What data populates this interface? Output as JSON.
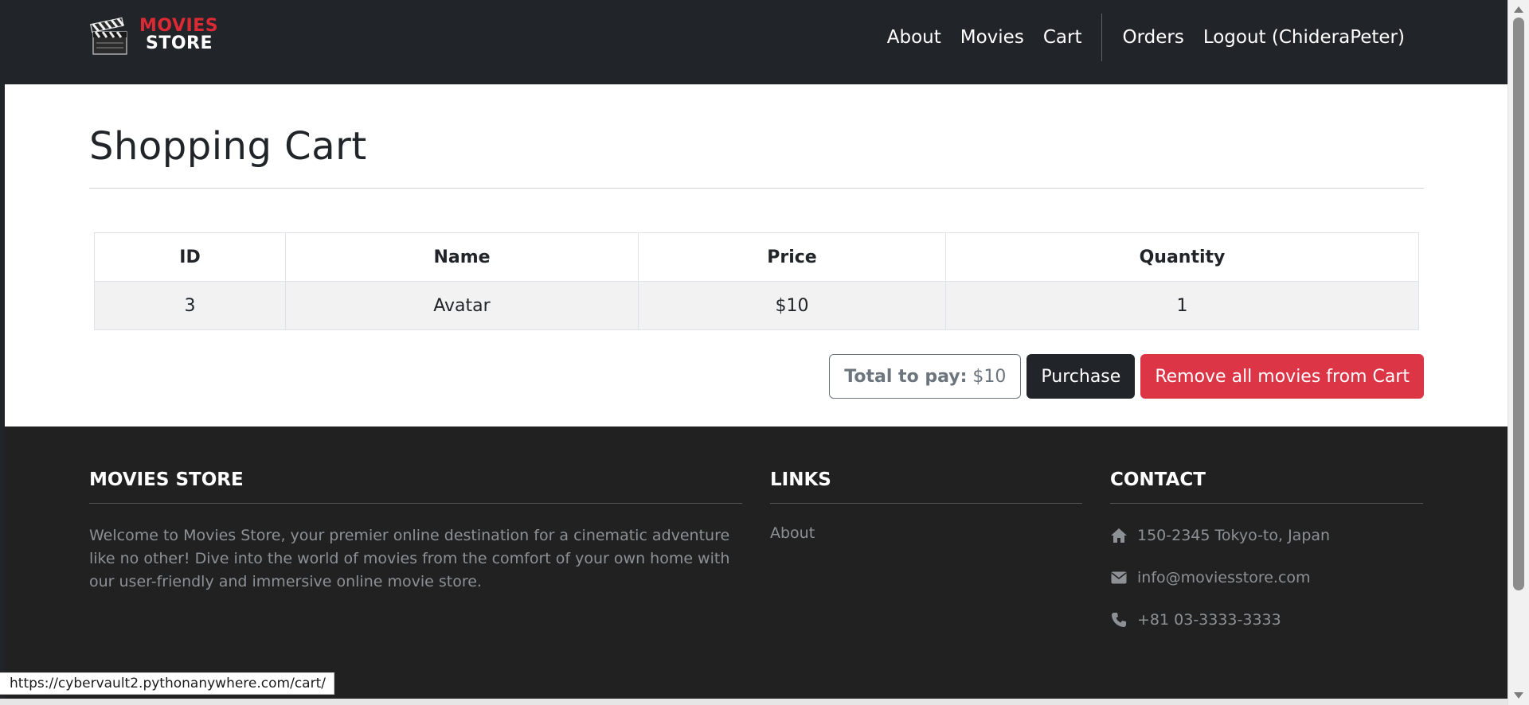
{
  "navbar": {
    "brand_line1": "MOVIES",
    "brand_line2": "STORE",
    "links": {
      "about": "About",
      "movies": "Movies",
      "cart": "Cart",
      "orders": "Orders",
      "logout": "Logout (ChideraPeter)"
    }
  },
  "main": {
    "title": "Shopping Cart",
    "table": {
      "headers": [
        "ID",
        "Name",
        "Price",
        "Quantity"
      ],
      "rows": [
        [
          "3",
          "Avatar",
          "$10",
          "1"
        ]
      ]
    },
    "total_label": "Total to pay:",
    "total_value": "$10",
    "purchase_label": "Purchase",
    "remove_all_label": "Remove all movies from Cart"
  },
  "footer": {
    "col1_title": "MOVIES STORE",
    "col1_text": "Welcome to Movies Store, your premier online destination for a cinematic adventure like no other! Dive into the world of movies from the comfort of your own home with our user-friendly and immersive online movie store.",
    "col2_title": "LINKS",
    "col2_links": [
      "About"
    ],
    "col3_title": "CONTACT",
    "address": "150-2345 Tokyo-to, Japan",
    "email": "info@moviesstore.com",
    "phone": "+81 03-3333-3333"
  },
  "status_url": "https://cybervault2.pythonanywhere.com/cart/",
  "colors": {
    "navbar_bg": "#212529",
    "brand_red": "#dc2a35",
    "danger": "#dc3545",
    "footer_bg": "#212121"
  },
  "icons": {
    "logo": "clapperboard-icon",
    "address": "home-icon",
    "email": "envelope-icon",
    "phone": "phone-icon"
  }
}
